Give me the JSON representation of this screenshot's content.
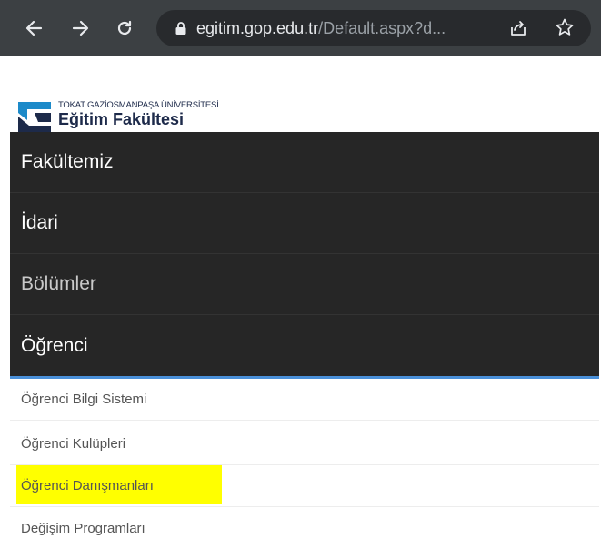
{
  "browser": {
    "url_host": "egitim.gop.edu.tr",
    "url_path": "/Default.aspx?d...",
    "icons": [
      "back-arrow-icon",
      "forward-arrow-icon",
      "reload-icon",
      "lock-icon",
      "share-icon",
      "star-icon"
    ]
  },
  "header": {
    "university": "TOKAT GAZİOSMANPAŞA ÜNİVERSİTESİ",
    "faculty": "Eğitim Fakültesi"
  },
  "menu": {
    "items": [
      {
        "label": "Fakültemiz"
      },
      {
        "label": "İdari"
      },
      {
        "label": "Bölümler"
      },
      {
        "label": "Öğrenci"
      }
    ]
  },
  "submenu": {
    "items": [
      {
        "label": "Öğrenci Bilgi Sistemi"
      },
      {
        "label": "Öğrenci Kulüpleri"
      },
      {
        "label": "Öğrenci Danışmanları",
        "highlighted": true
      },
      {
        "label": "Değişim Programları"
      }
    ]
  },
  "colors": {
    "chrome_bg": "#3c4043",
    "omnibox_bg": "#282a2d",
    "menu_bg": "#262626",
    "menu_accent": "#4a90d9",
    "highlight": "#ffff00"
  }
}
